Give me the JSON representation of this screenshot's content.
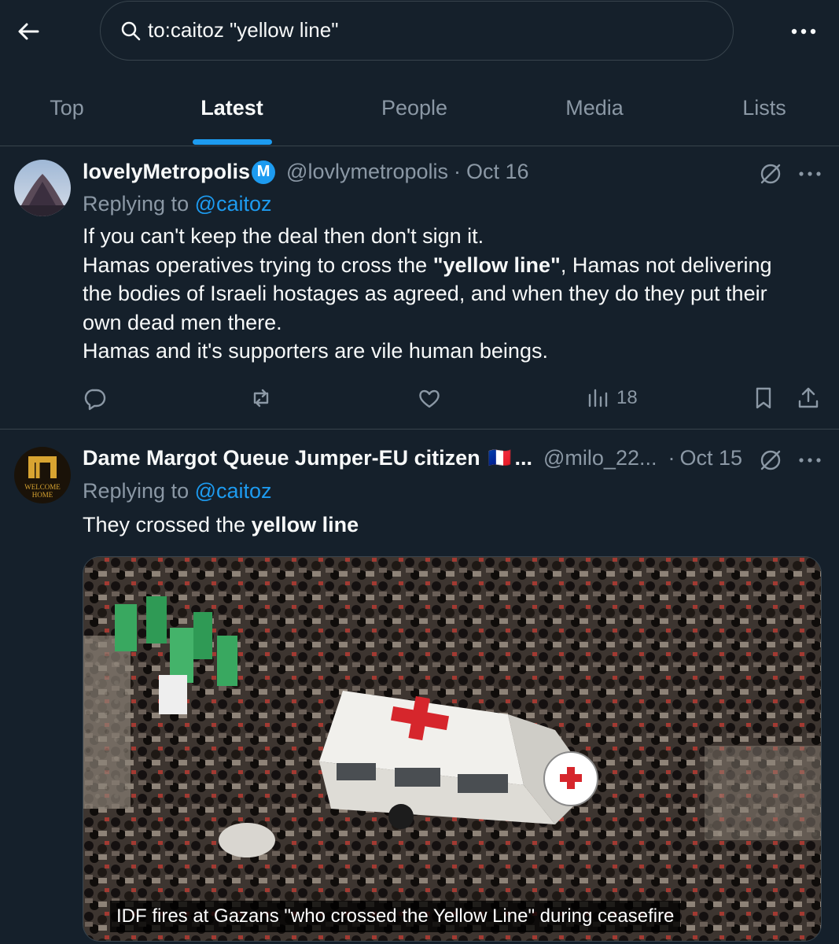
{
  "search": {
    "query": "to:caitoz \"yellow line\""
  },
  "icons": {
    "back": "arrow-left-icon",
    "search": "search-icon",
    "more": "more-horizontal-icon",
    "grok": "grok-icon",
    "reply": "reply-icon",
    "repost": "repost-icon",
    "like": "like-icon",
    "views": "views-icon",
    "bookmark": "bookmark-icon",
    "share": "share-icon"
  },
  "tabs": [
    {
      "label": "Top",
      "active": false
    },
    {
      "label": "Latest",
      "active": true
    },
    {
      "label": "People",
      "active": false
    },
    {
      "label": "Media",
      "active": false
    },
    {
      "label": "Lists",
      "active": false
    }
  ],
  "colors": {
    "background": "#15202b",
    "accent": "#1d9bf0",
    "secondary_text": "#8b98a5",
    "border": "#38444d"
  },
  "tweets": [
    {
      "display_name": "lovelyMetropolis",
      "badge": "M",
      "handle": "@lovlymetropolis",
      "separator": "·",
      "date": "Oct 16",
      "replying_prefix": "Replying to",
      "replying_to": "@caitoz",
      "line1": "If you can't keep the deal then don't sign it.",
      "line2_before": "Hamas operatives trying to cross the ",
      "line2_bold": "\"yellow line\"",
      "line2_after": ", Hamas not delivering",
      "line3": "the bodies of Israeli hostages as agreed, and when they do they put their",
      "line4": "own dead men there.",
      "line5": "Hamas and it's supporters are vile human beings.",
      "views": "18"
    },
    {
      "display_name": "Dame Margot Queue Jumper-EU citizen",
      "flag": "🇫🇷",
      "ellipsis": "...",
      "handle": "@milo_22...",
      "separator": "·",
      "date": "Oct 15",
      "replying_prefix": "Replying to",
      "replying_to": "@caitoz",
      "text_before": "They crossed the ",
      "text_bold": "yellow line",
      "avatar_text1": "WELCOME",
      "avatar_text2": "HOME",
      "media_caption": "IDF fires at Gazans \"who crossed the Yellow Line\" during ceasefire"
    }
  ]
}
